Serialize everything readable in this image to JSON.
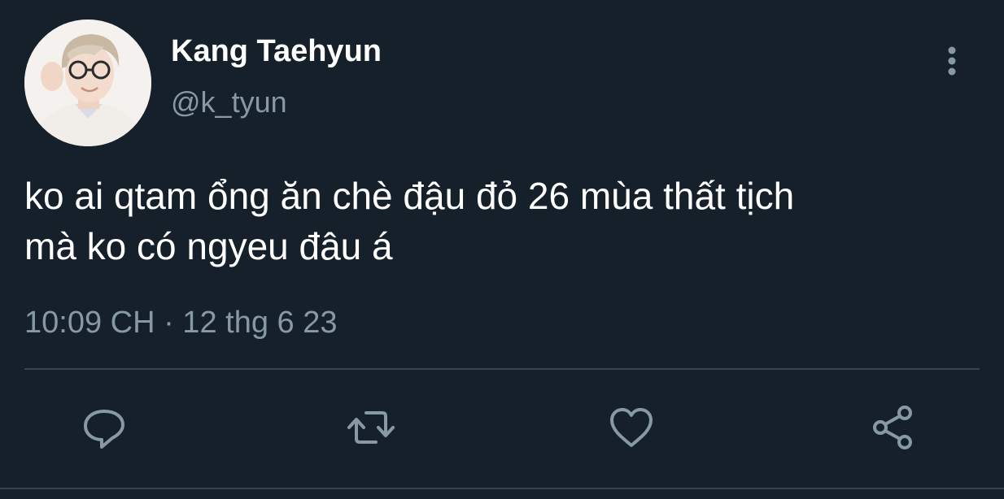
{
  "tweet": {
    "display_name": "Kang Taehyun",
    "handle": "@k_tyun",
    "text": "ko ai qtam ổng ăn chè đậu đỏ 26 mùa thất tịch\nmà ko có ngyeu đâu á",
    "timestamp": "10:09 CH · 12 thg 6 23"
  },
  "icons": {
    "more": "more-vertical-icon",
    "reply": "reply-icon",
    "retweet": "retweet-icon",
    "like": "heart-icon",
    "share": "share-icon"
  },
  "colors": {
    "background": "#15202b",
    "primary_text": "#ffffff",
    "secondary_text": "#8899a6",
    "divider": "#38444d"
  }
}
